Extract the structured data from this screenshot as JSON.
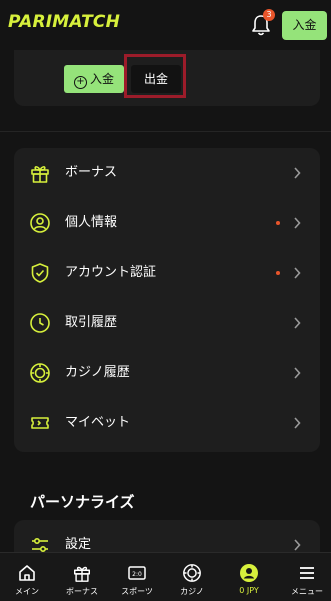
{
  "header": {
    "logo": "PARIMATCH",
    "notification_count": "3",
    "deposit_label": "入金"
  },
  "account_card": {
    "deposit_label": "入金",
    "withdraw_label": "出金"
  },
  "menu": {
    "items": [
      {
        "label": "ボーナス",
        "icon": "gift-icon",
        "has_dot": false
      },
      {
        "label": "個人情報",
        "icon": "user-icon",
        "has_dot": true
      },
      {
        "label": "アカウント認証",
        "icon": "shield-check-icon",
        "has_dot": true
      },
      {
        "label": "取引履歴",
        "icon": "clock-icon",
        "has_dot": false
      },
      {
        "label": "カジノ履歴",
        "icon": "chip-icon",
        "has_dot": false
      },
      {
        "label": "マイベット",
        "icon": "ticket-icon",
        "has_dot": false
      }
    ]
  },
  "personalize": {
    "title": "パーソナライズ",
    "settings_label": "設定"
  },
  "bottom_nav": {
    "items": [
      {
        "label": "メイン",
        "icon": "home-icon"
      },
      {
        "label": "ボーナス",
        "icon": "gift-icon"
      },
      {
        "label": "スポーツ",
        "icon": "scoreboard-icon"
      },
      {
        "label": "カジノ",
        "icon": "chip-icon"
      },
      {
        "label": "0 JPY",
        "icon": "profile-icon",
        "active": true
      },
      {
        "label": "メニュー",
        "icon": "hamburger-icon"
      }
    ]
  },
  "colors": {
    "accent": "#d7f03c",
    "deposit_green": "#95e37a",
    "dot_orange": "#e8552b",
    "highlight_red": "#9c1c2a"
  }
}
